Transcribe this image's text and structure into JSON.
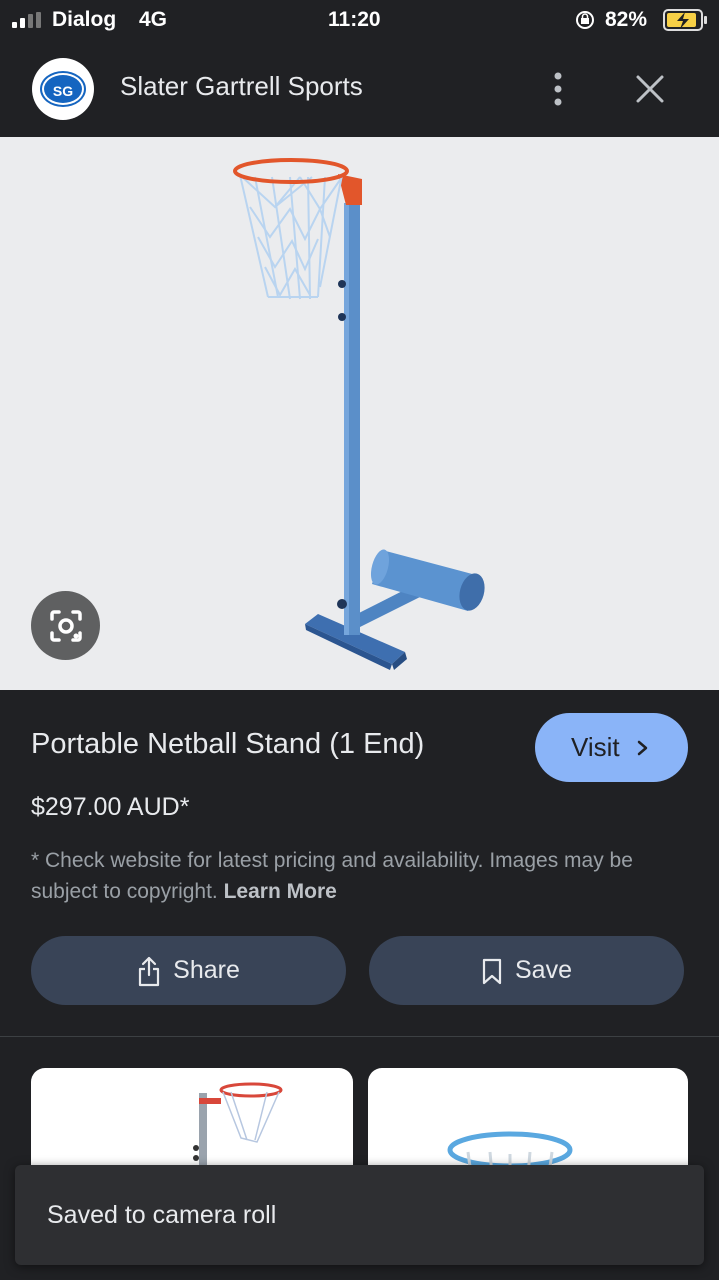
{
  "status_bar": {
    "carrier": "Dialog",
    "network": "4G",
    "time": "11:20",
    "battery": "82%"
  },
  "header": {
    "logo_text": "SG",
    "site_name": "Slater Gartrell Sports",
    "icons": [
      "more-vert-icon",
      "close-icon"
    ]
  },
  "product": {
    "title": "Portable Netball Stand (1 End)",
    "price": "$297.00 AUD*",
    "disclaimer": "* Check website for latest pricing and availability. Images may be subject to copyright.",
    "learn_more": "Learn More"
  },
  "buttons": {
    "visit": "Visit",
    "share": "Share",
    "save": "Save"
  },
  "toast": {
    "message": "Saved to camera roll"
  },
  "colors": {
    "background": "#202124",
    "visit_button": "#8ab4f8",
    "action_button": "#394457",
    "pole_blue": "#5b8fc9",
    "hoop_orange": "#e2562b"
  }
}
